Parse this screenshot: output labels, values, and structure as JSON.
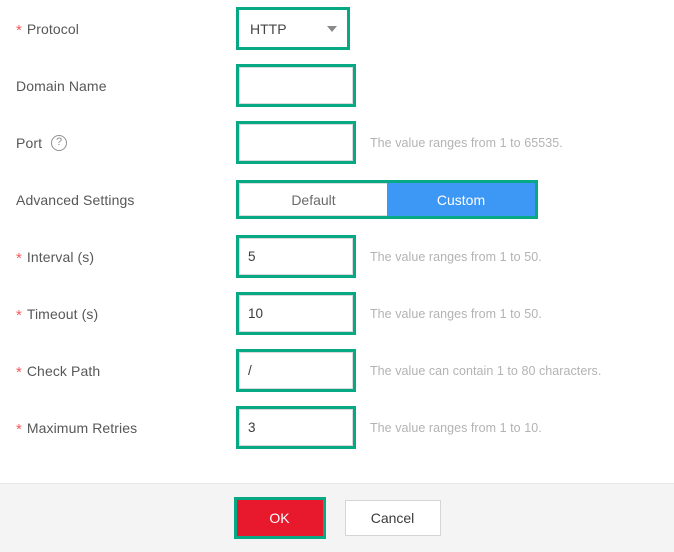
{
  "form": {
    "rows": [
      {
        "id": "protocol",
        "required": true,
        "label": "Protocol",
        "control": "select",
        "value": "HTTP",
        "hint": "",
        "highlighted": true,
        "help": false
      },
      {
        "id": "domain-name",
        "required": false,
        "label": "Domain Name",
        "control": "text",
        "value": "",
        "placeholder": "",
        "hint": "",
        "highlighted": true,
        "help": false
      },
      {
        "id": "port",
        "required": false,
        "label": "Port",
        "control": "text",
        "value": "",
        "placeholder": "",
        "hint": "The value ranges from 1 to 65535.",
        "highlighted": true,
        "help": true,
        "help_icon": "question-circle-icon"
      },
      {
        "id": "advanced-settings",
        "required": false,
        "label": "Advanced Settings",
        "control": "segmented",
        "options": [
          "Default",
          "Custom"
        ],
        "selected": "Custom",
        "hint": "",
        "highlighted": true,
        "help": false
      },
      {
        "id": "interval",
        "required": true,
        "label": "Interval (s)",
        "control": "text",
        "value": "5",
        "placeholder": "",
        "hint": "The value ranges from 1 to 50.",
        "highlighted": true,
        "help": false
      },
      {
        "id": "timeout",
        "required": true,
        "label": "Timeout (s)",
        "control": "text",
        "value": "10",
        "placeholder": "",
        "hint": "The value ranges from 1 to 50.",
        "highlighted": true,
        "help": false
      },
      {
        "id": "check-path",
        "required": true,
        "label": "Check Path",
        "control": "text",
        "value": "/",
        "placeholder": "",
        "hint": "The value can contain 1 to 80 characters.",
        "highlighted": true,
        "help": false
      },
      {
        "id": "maximum-retries",
        "required": true,
        "label": "Maximum Retries",
        "control": "text",
        "value": "3",
        "placeholder": "",
        "hint": "The value ranges from 1 to 10.",
        "highlighted": true,
        "help": false
      }
    ],
    "required_marker": "*"
  },
  "footer": {
    "ok_label": "OK",
    "cancel_label": "Cancel",
    "ok_highlighted": true
  },
  "colors": {
    "highlight_ring": "#07a884",
    "primary_button": "#e8192c",
    "segment_active": "#3d97f5",
    "required_star": "#fa5a5a",
    "label_text": "#575757",
    "hint_text": "#b3b3b3",
    "footer_bg": "#f4f4f4",
    "page_bg": "#ffffff"
  }
}
